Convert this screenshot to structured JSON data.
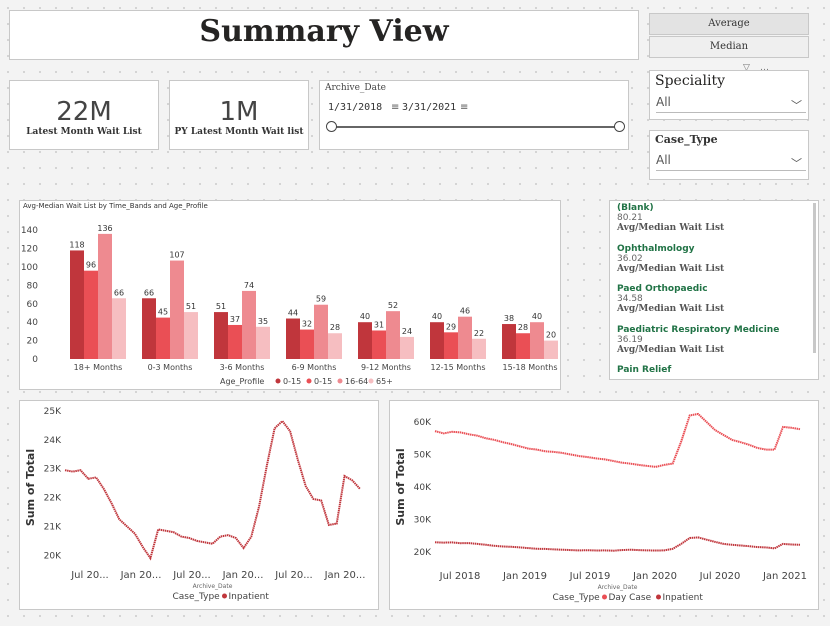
{
  "header": {
    "title": "Summary View"
  },
  "toggle": {
    "average_label": "Average",
    "median_label": "Median"
  },
  "cards": [
    {
      "value": "22M",
      "label": "Latest Month Wait List"
    },
    {
      "value": "1M",
      "label": "PY Latest Month Wait list"
    }
  ],
  "archive_date": {
    "title": "Archive_Date",
    "start": "1/31/2018",
    "end": "3/31/2021"
  },
  "filters": {
    "speciality": {
      "title": "Speciality",
      "value": "All"
    },
    "case_type": {
      "title": "Case_Type",
      "value": "All"
    }
  },
  "speciality_list": [
    {
      "name": "(Blank)",
      "value": "80.21",
      "label": "Avg/Median Wait List"
    },
    {
      "name": "Ophthalmology",
      "value": "36.02",
      "label": "Avg/Median Wait List"
    },
    {
      "name": "Paed Orthopaedic",
      "value": "34.58",
      "label": "Avg/Median Wait List"
    },
    {
      "name": "Paediatric Respiratory Medicine",
      "value": "36.19",
      "label": "Avg/Median Wait List"
    },
    {
      "name": "Pain Relief",
      "value": "",
      "label": ""
    }
  ],
  "colors": {
    "dark_red": "#c0363c",
    "red": "#ea4f55",
    "pink": "#ee8a90",
    "light_pink": "#f6bec1",
    "title_text": "#252423",
    "green_text": "#217346"
  },
  "chart_data": [
    {
      "type": "bar",
      "title": "Avg-Median Wait List by Time_Bands and Age_Profile",
      "categories": [
        "18+ Months",
        "0-3 Months",
        "3-6 Months",
        "6-9 Months",
        "9-12 Months",
        "12-15 Months",
        "15-18 Months"
      ],
      "series": [
        {
          "name": "0-15",
          "values": [
            118,
            66,
            51,
            44,
            40,
            40,
            38
          ]
        },
        {
          "name": "0-15",
          "values": [
            96,
            45,
            37,
            32,
            31,
            29,
            28
          ]
        },
        {
          "name": "16-64",
          "values": [
            136,
            107,
            74,
            59,
            52,
            46,
            40
          ]
        },
        {
          "name": "65+",
          "values": [
            66,
            51,
            35,
            28,
            24,
            22,
            20
          ]
        }
      ],
      "legend_title": "Age_Profile",
      "legend_position": "bottom",
      "yticks": [
        0,
        20,
        40,
        60,
        80,
        100,
        120,
        140
      ],
      "ylim": [
        0,
        150
      ]
    },
    {
      "type": "line",
      "ylabel": "Sum of Total",
      "xlabel": "Archive_Date",
      "legend_title": "Case_Type",
      "legend_position": "bottom",
      "yticks": [
        "20K",
        "21K",
        "22K",
        "23K",
        "24K",
        "25K"
      ],
      "ytick_values": [
        20000,
        21000,
        22000,
        23000,
        24000,
        25000
      ],
      "ylim": [
        19700,
        25000
      ],
      "xticks": [
        "Jul 20...",
        "Jan 20...",
        "Jul 20...",
        "Jan 20...",
        "Jul 20...",
        "Jan 20..."
      ],
      "series": [
        {
          "name": "Inpatient",
          "values": [
            22950,
            22900,
            22950,
            22650,
            22700,
            22300,
            21800,
            21250,
            21000,
            20750,
            20300,
            19900,
            20900,
            20850,
            20800,
            20650,
            20600,
            20500,
            20450,
            20400,
            20650,
            20700,
            20600,
            20250,
            20650,
            21700,
            23100,
            24400,
            24650,
            24300,
            23300,
            22400,
            21950,
            21900,
            21050,
            21100,
            22750,
            22600,
            22300
          ]
        }
      ]
    },
    {
      "type": "line",
      "ylabel": "Sum of Total",
      "xlabel": "Archive_Date",
      "legend_title": "Case_Type",
      "legend_position": "bottom",
      "yticks": [
        "20K",
        "30K",
        "40K",
        "50K",
        "60K"
      ],
      "ytick_values": [
        20000,
        30000,
        40000,
        50000,
        60000
      ],
      "ylim": [
        16000,
        64000
      ],
      "xticks": [
        "Jul 2018",
        "Jan 2019",
        "Jul 2019",
        "Jan 2020",
        "Jul 2020",
        "Jan 2021"
      ],
      "series": [
        {
          "name": "Day Case",
          "values": [
            57200,
            56500,
            57000,
            56800,
            56200,
            55800,
            55000,
            54500,
            53800,
            53200,
            52500,
            51800,
            51500,
            51000,
            50800,
            50500,
            50000,
            49500,
            49200,
            48800,
            48500,
            48000,
            47500,
            47200,
            46800,
            46500,
            46200,
            46800,
            47200,
            54000,
            62000,
            62500,
            60000,
            57500,
            56000,
            54500,
            53800,
            53000,
            52000,
            51500,
            51500,
            58500,
            58200,
            57800
          ]
        },
        {
          "name": "Inpatient",
          "values": [
            23000,
            22900,
            22950,
            22700,
            22750,
            22500,
            22200,
            21900,
            21700,
            21600,
            21400,
            21200,
            21000,
            20950,
            20800,
            20700,
            20600,
            20500,
            20550,
            20450,
            20500,
            20400,
            20600,
            20700,
            20600,
            20500,
            20450,
            20500,
            21000,
            22500,
            24300,
            24500,
            23800,
            23100,
            22500,
            22200,
            22000,
            21800,
            21500,
            21400,
            21100,
            22500,
            22300,
            22200
          ]
        }
      ]
    }
  ]
}
